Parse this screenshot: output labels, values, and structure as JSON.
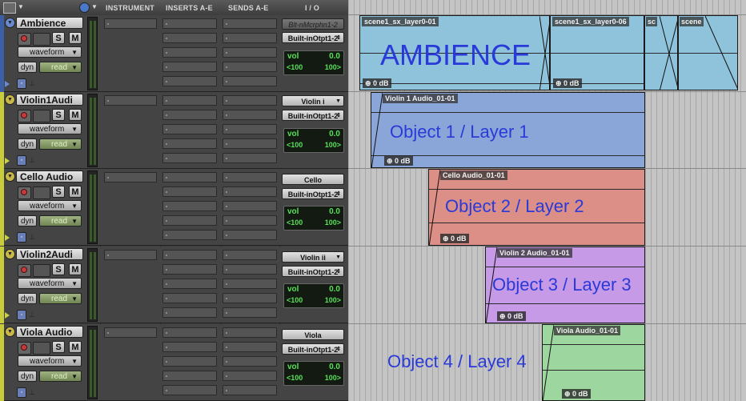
{
  "header": {
    "columns": [
      "INSTRUMENT",
      "INSERTS A-E",
      "SENDS A-E",
      "I / O"
    ]
  },
  "colors": {
    "track_bar_ambience": "#3d5fa8",
    "track_bar_other": "#c8cc3a",
    "clip_ambience": "#8fc3dc",
    "clip_violin1": "#8aa6d8",
    "clip_cello": "#dc8f86",
    "clip_violin2": "#c69ae6",
    "clip_viola": "#9ed6a0",
    "overlay_text": "#2a3ad8"
  },
  "tracks": [
    {
      "name": "Ambience",
      "s_label": "S",
      "m_label": "M",
      "view": "waveform",
      "dyn_label": "dyn",
      "automation": "read",
      "input": "Blt-nMcrphn1-2",
      "output": "Built-inOtpt1-2",
      "vol_label": "vol",
      "vol_value": "0.0",
      "pan_left": "<100",
      "pan_right": "100>"
    },
    {
      "name": "Violin1Audi",
      "s_label": "S",
      "m_label": "M",
      "view": "waveform",
      "dyn_label": "dyn",
      "automation": "read",
      "input": "Violin i",
      "output": "Built-inOtpt1-2",
      "vol_label": "vol",
      "vol_value": "0.0",
      "pan_left": "<100",
      "pan_right": "100>"
    },
    {
      "name": "Cello Audio",
      "s_label": "S",
      "m_label": "M",
      "view": "waveform",
      "dyn_label": "dyn",
      "automation": "read",
      "input": "Cello",
      "output": "Built-inOtpt1-2",
      "vol_label": "vol",
      "vol_value": "0.0",
      "pan_left": "<100",
      "pan_right": "100>"
    },
    {
      "name": "Violin2Audi",
      "s_label": "S",
      "m_label": "M",
      "view": "waveform",
      "dyn_label": "dyn",
      "automation": "read",
      "input": "Violin ii",
      "output": "Built-inOtpt1-2",
      "vol_label": "vol",
      "vol_value": "0.0",
      "pan_left": "<100",
      "pan_right": "100>"
    },
    {
      "name": "Viola Audio",
      "s_label": "S",
      "m_label": "M",
      "view": "waveform",
      "dyn_label": "dyn",
      "automation": "read",
      "input": "Viola",
      "output": "Built-inOtpt1-2",
      "vol_label": "vol",
      "vol_value": "0.0",
      "pan_left": "<100",
      "pan_right": "100>"
    }
  ],
  "clips": {
    "ambience_1": {
      "name": "scene1_sx_layer0-01",
      "gain": "0 dB"
    },
    "ambience_2": {
      "name": "scene1_sx_layer0-06",
      "gain": "0 dB"
    },
    "ambience_3": {
      "name": "sc"
    },
    "ambience_4": {
      "name": "scene"
    },
    "violin1": {
      "name": "Violin 1 Audio_01-01",
      "gain": "0 dB"
    },
    "cello": {
      "name": "Cello Audio_01-01",
      "gain": "0 dB"
    },
    "violin2": {
      "name": "Violin 2 Audio_01-01",
      "gain": "0 dB"
    },
    "viola": {
      "name": "Viola Audio_01-01",
      "gain": "0 dB"
    }
  },
  "overlays": {
    "ambience": "AMBIENCE",
    "object1": "Object 1 / Layer 1",
    "object2": "Object 2 / Layer 2",
    "object3": "Object 3 / Layer 3",
    "object4": "Object 4 / Layer 4"
  }
}
